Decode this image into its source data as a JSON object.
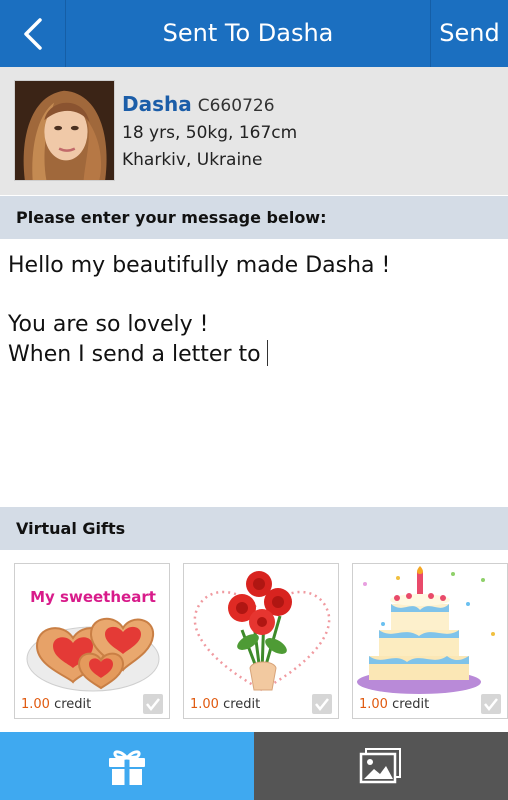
{
  "header": {
    "title": "Sent To Dasha",
    "send_label": "Send",
    "bar_color": "#1b6fc0"
  },
  "profile": {
    "name": "Dasha",
    "id": "C660726",
    "stats": "18 yrs, 50kg, 167cm",
    "location": "Kharkiv, Ukraine"
  },
  "message_section": {
    "label": "Please enter your message below:",
    "text": "Hello my beautifully made Dasha !\n\nYou are so lovely !\nWhen I send a letter to"
  },
  "gifts_section": {
    "label": "Virtual Gifts",
    "items": [
      {
        "name": "cookies",
        "art_text": "My sweetheart",
        "amount": "1.00",
        "unit": "credit",
        "checked": false
      },
      {
        "name": "roses",
        "amount": "1.00",
        "unit": "credit",
        "checked": false
      },
      {
        "name": "cake",
        "amount": "1.00",
        "unit": "credit",
        "checked": false
      }
    ]
  },
  "bottom_tabs": [
    {
      "name": "gift",
      "icon": "gift-icon",
      "active": true,
      "color": "#3fa9f0"
    },
    {
      "name": "photo",
      "icon": "picture-icon",
      "active": false,
      "color": "#555555"
    }
  ]
}
